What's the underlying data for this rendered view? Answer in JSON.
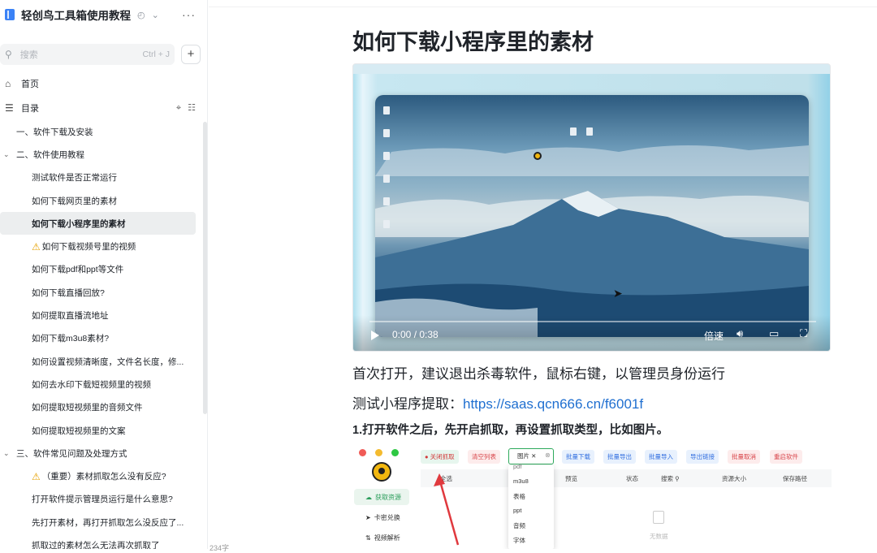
{
  "sidebar": {
    "title": "轻创鸟工具箱使用教程",
    "more_icon": "more-horizontal-icon",
    "search": {
      "placeholder": "搜索",
      "shortcut": "Ctrl + J"
    },
    "nav": [
      {
        "label": "首页",
        "icon": "home-icon"
      },
      {
        "label": "目录",
        "icon": "list-icon"
      }
    ],
    "toc": [
      {
        "label": "一、软件下载及安装",
        "level": 1
      },
      {
        "label": "二、软件使用教程",
        "level": 1,
        "open": true
      },
      {
        "label": "测试软件是否正常运行",
        "level": 2
      },
      {
        "label": "如何下载网页里的素材",
        "level": 2
      },
      {
        "label": "如何下载小程序里的素材",
        "level": 2,
        "active": true
      },
      {
        "label": "如何下载视频号里的视频",
        "level": 2,
        "warn": true
      },
      {
        "label": "如何下载pdf和ppt等文件",
        "level": 2
      },
      {
        "label": "如何下载直播回放?",
        "level": 2
      },
      {
        "label": "如何提取直播流地址",
        "level": 2
      },
      {
        "label": "如何下载m3u8素材?",
        "level": 2
      },
      {
        "label": "如何设置视频清晰度，文件名长度，修...",
        "level": 2
      },
      {
        "label": "如何去水印下载短视频里的视频",
        "level": 2
      },
      {
        "label": "如何提取短视频里的音频文件",
        "level": 2
      },
      {
        "label": "如何提取短视频里的文案",
        "level": 2
      },
      {
        "label": "三、软件常见问题及处理方式",
        "level": 1,
        "open": true
      },
      {
        "label": "（重要）素材抓取怎么没有反应?",
        "level": 2,
        "warn": true
      },
      {
        "label": "打开软件提示管理员运行是什么意思?",
        "level": 2
      },
      {
        "label": "先打开素材，再打开抓取怎么没反应了...",
        "level": 2
      },
      {
        "label": "抓取过的素材怎么无法再次抓取了",
        "level": 2
      }
    ],
    "word_count": "234字"
  },
  "main": {
    "title": "如何下载小程序里的素材",
    "video": {
      "time": "0:00 / 0:38",
      "speed_label": "倍速"
    },
    "para1": "首次打开，建议退出杀毒软件，鼠标右键，以管理员身份运行",
    "para2_prefix": "测试小程序提取：",
    "para2_link": "https://saas.qcn666.cn/f6001f",
    "step1": "1.打开软件之后，先开启抓取，再设置抓取类型，比如图片。",
    "app": {
      "side_nav": [
        "获取资源",
        "卡密兑换",
        "视频解析"
      ],
      "toolbar": [
        "关闭抓取",
        "清空列表",
        "批量下载",
        "批量导出",
        "批量导入",
        "导出链接",
        "批量取消",
        "重启软件"
      ],
      "select_value": "图片",
      "columns": [
        "全选",
        "预览",
        "状态",
        "搜索",
        "资源大小",
        "保存路径"
      ],
      "dropdown": [
        "pdf",
        "m3u8",
        "表格",
        "ppt",
        "音频",
        "字体"
      ],
      "empty": "无数据"
    }
  },
  "colors": {
    "link": "#1f6fd0",
    "accent_green": "#2eaa5c",
    "brand": "#3b82f6"
  }
}
